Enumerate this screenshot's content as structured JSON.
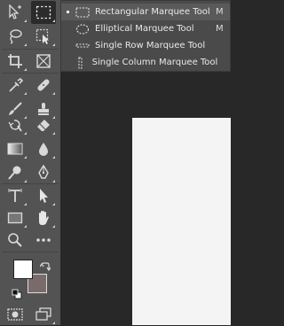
{
  "toolbar": {
    "tools": [
      {
        "name": "move-tool",
        "icon": "move-icon"
      },
      {
        "name": "rectangular-marquee-tool",
        "icon": "marquee-icon",
        "active": true
      },
      {
        "name": "lasso-tool",
        "icon": "lasso-icon"
      },
      {
        "name": "object-selection-tool",
        "icon": "object-selection-icon"
      },
      {
        "name": "crop-tool",
        "icon": "crop-icon"
      },
      {
        "name": "frame-tool",
        "icon": "frame-icon"
      },
      {
        "name": "eyedropper-tool",
        "icon": "eyedropper-icon"
      },
      {
        "name": "healing-brush-tool",
        "icon": "bandage-icon"
      },
      {
        "name": "brush-tool",
        "icon": "brush-icon"
      },
      {
        "name": "clone-stamp-tool",
        "icon": "stamp-icon"
      },
      {
        "name": "history-brush-tool",
        "icon": "history-brush-icon"
      },
      {
        "name": "eraser-tool",
        "icon": "eraser-icon"
      },
      {
        "name": "gradient-tool",
        "icon": "gradient-icon"
      },
      {
        "name": "blur-tool",
        "icon": "drop-icon"
      },
      {
        "name": "dodge-tool",
        "icon": "dodge-icon"
      },
      {
        "name": "pen-tool",
        "icon": "pen-icon"
      },
      {
        "name": "type-tool",
        "icon": "type-icon"
      },
      {
        "name": "path-selection-tool",
        "icon": "arrow-icon"
      },
      {
        "name": "rectangle-tool",
        "icon": "rectangle-icon"
      },
      {
        "name": "hand-tool",
        "icon": "hand-icon"
      },
      {
        "name": "zoom-tool",
        "icon": "zoom-icon"
      },
      {
        "name": "more-tools",
        "icon": "ellipsis-icon"
      }
    ],
    "colors": {
      "foreground": "#ffffff",
      "background": "#7a6b6b"
    }
  },
  "flyout": {
    "items": [
      {
        "label": "Rectangular Marquee Tool",
        "shortcut": "M",
        "icon": "rectangular-marquee-icon",
        "selected": true
      },
      {
        "label": "Elliptical Marquee Tool",
        "shortcut": "M",
        "icon": "elliptical-marquee-icon"
      },
      {
        "label": "Single Row Marquee Tool",
        "shortcut": "",
        "icon": "single-row-marquee-icon"
      },
      {
        "label": "Single Column Marquee Tool",
        "shortcut": "",
        "icon": "single-column-marquee-icon"
      }
    ]
  }
}
